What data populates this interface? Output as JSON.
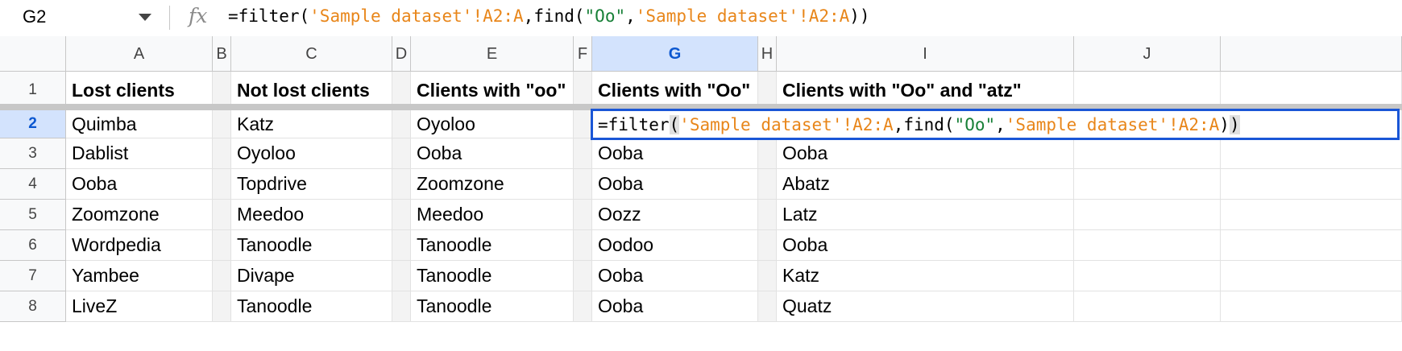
{
  "formula_bar": {
    "cell_ref": "G2",
    "fx_label": "fx",
    "formula_parts": [
      {
        "text": "=filter(",
        "kind": "plain"
      },
      {
        "text": "'Sample dataset'!A2:A",
        "kind": "str"
      },
      {
        "text": ",find(",
        "kind": "plain"
      },
      {
        "text": "\"Oo\"",
        "kind": "lit"
      },
      {
        "text": ",",
        "kind": "plain"
      },
      {
        "text": "'Sample dataset'!A2:A",
        "kind": "str"
      },
      {
        "text": "))",
        "kind": "plain"
      }
    ]
  },
  "columns": [
    "A",
    "B",
    "C",
    "D",
    "E",
    "F",
    "G",
    "H",
    "I",
    "J"
  ],
  "selected_column": "G",
  "rows": [
    "1",
    "2",
    "3",
    "4",
    "5",
    "6",
    "7",
    "8"
  ],
  "selected_row": "2",
  "header_row": {
    "A": "Lost clients",
    "C": "Not lost clients",
    "E": "Clients with \"oo\"",
    "G": "Clients with \"Oo\"",
    "I": "Clients with \"Oo\" and \"atz\""
  },
  "data_rows": [
    {
      "A": "Quimba",
      "C": "Katz",
      "E": "Oyoloo",
      "G": "",
      "I": ""
    },
    {
      "A": "Dablist",
      "C": "Oyoloo",
      "E": "Ooba",
      "G": "Ooba",
      "I": "Ooba"
    },
    {
      "A": "Ooba",
      "C": "Topdrive",
      "E": "Zoomzone",
      "G": "Ooba",
      "I": "Abatz"
    },
    {
      "A": "Zoomzone",
      "C": "Meedoo",
      "E": "Meedoo",
      "G": "Oozz",
      "I": "Latz"
    },
    {
      "A": "Wordpedia",
      "C": "Tanoodle",
      "E": "Tanoodle",
      "G": "Oodoo",
      "I": "Ooba"
    },
    {
      "A": "Yambee",
      "C": "Divape",
      "E": "Tanoodle",
      "G": "Ooba",
      "I": "Katz"
    },
    {
      "A": "LiveZ",
      "C": "Tanoodle",
      "E": "Tanoodle",
      "G": "Ooba",
      "I": "Quatz"
    }
  ],
  "colors": {
    "string": "#e8861a",
    "literal": "#188038",
    "selection": "#1a56d6",
    "selected_header_bg": "#d3e3fd"
  }
}
